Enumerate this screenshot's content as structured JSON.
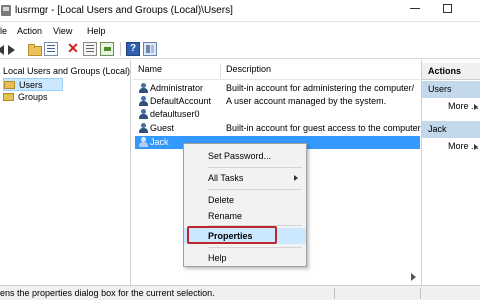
{
  "window": {
    "title": "lusrmgr - [Local Users and Groups (Local)\\Users]"
  },
  "menu": [
    "le",
    "Action",
    "View",
    "Help"
  ],
  "toolbar": {
    "icons": [
      "back-arrow-icon",
      "forward-arrow-icon",
      "up-folder-icon",
      "show-hide-tree-icon",
      "delete-icon",
      "properties-icon",
      "export-list-icon",
      "help-icon",
      "action-pane-icon"
    ]
  },
  "tree": {
    "root": "Local Users and Groups (Local)",
    "items": [
      "Users",
      "Groups"
    ]
  },
  "list": {
    "columns": [
      "Name",
      "Description"
    ],
    "rows": [
      {
        "name": "Administrator",
        "description": "Built-in account for administering the computer/"
      },
      {
        "name": "DefaultAccount",
        "description": "A user account managed by the system."
      },
      {
        "name": "defaultuser0",
        "description": ""
      },
      {
        "name": "Guest",
        "description": "Built-in account for guest access to the computer"
      },
      {
        "name": "Jack",
        "description": ""
      }
    ],
    "selected": "Jack"
  },
  "context_menu": {
    "items": [
      "Set Password...",
      "All Tasks",
      "Delete",
      "Rename",
      "Properties",
      "Help"
    ],
    "highlighted": "Properties"
  },
  "actions": {
    "title": "Actions",
    "sections": [
      {
        "name": "Users",
        "more": "More ..."
      },
      {
        "name": "Jack",
        "more": "More ..."
      }
    ]
  },
  "status": {
    "text": "ens the properties dialog box for the current selection."
  },
  "colors": {
    "selection": "#3399ff",
    "highlight_box": "#c0262d",
    "actions_header": "#c4d8ec"
  }
}
